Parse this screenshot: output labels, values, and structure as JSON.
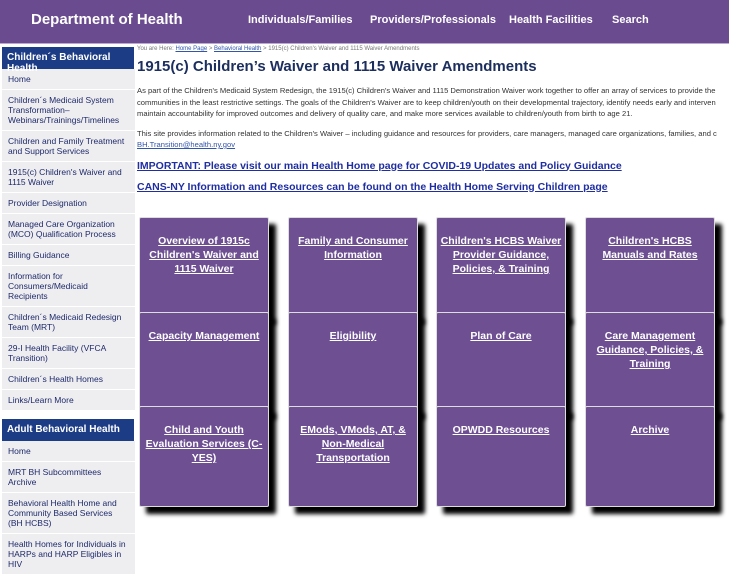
{
  "header": {
    "brand": "Department of Health",
    "nav": [
      "Individuals/Families",
      "Providers/Professionals",
      "Health Facilities",
      "Search"
    ]
  },
  "sidebar": {
    "section1": {
      "title": "Children´s Behavioral Health",
      "items": [
        "Home",
        "Children´s Medicaid System Transformation– Webinars/Trainings/Timelines",
        "Children and Family Treatment and Support Services",
        "1915(c) Children's Waiver and 1115 Waiver",
        "Provider Designation",
        "Managed Care Organization (MCO) Qualification Process",
        "Billing Guidance",
        "Information for Consumers/Medicaid Recipients",
        "Children´s Medicaid Redesign Team (MRT)",
        "29-I Health Facility (VFCA Transition)",
        "Children´s Health Homes",
        "Links/Learn More"
      ]
    },
    "section2": {
      "title": "Adult Behavioral Health",
      "items": [
        "Home",
        "MRT BH Subcommittees Archive",
        "Behavioral Health Home and Community Based Services (BH HCBS)",
        "Health Homes for Individuals in HARPs and HARP Eligibles in HIV"
      ]
    }
  },
  "breadcrumb": {
    "prefix": "You are Here: ",
    "home": "Home Page",
    "sep": " > ",
    "section": "Behavioral Health",
    "current": "1915(c) Children's Waiver and 1115 Waiver Amendments"
  },
  "main": {
    "title": "1915(c) Children’s Waiver and 1115 Waiver Amendments",
    "para1": [
      "As part of the Children's Medicaid System Redesign, the 1915(c) Children's Waiver and 1115 Demonstration Waiver work together to offer an array of services to provide the",
      "communities in the least restrictive settings. The goals of the Children's Waiver are to keep children/youth on their developmental trajectory, identify needs early and interven",
      "maintain accountability for improved outcomes and delivery of quality care, and make more services available to children/youth from birth to age 21."
    ],
    "para2": "This site provides information related to the Children's Waiver – including guidance and resources for providers, care managers, managed care organizations, families, and c",
    "email": "BH.Transition@health.ny.gov",
    "notice1": "IMPORTANT: Please visit our main Health Home page for COVID-19 Updates and Policy Guidance",
    "notice2": "CANS-NY Information and Resources can be found on the Health Home Serving Children page",
    "tiles": [
      "Overview of 1915c Children's Waiver and 1115 Waiver",
      "Family and Consumer Information",
      "Children's HCBS Waiver Provider Guidance, Policies, & Training",
      "Children's HCBS Manuals and Rates",
      "Capacity Management",
      "Eligibility",
      "Plan of Care",
      "Care Management Guidance, Policies, & Training",
      "Child and Youth Evaluation Services (C-YES)",
      "EMods, VMods, AT, & Non-Medical Transportation",
      "OPWDD Resources",
      "Archive"
    ]
  }
}
